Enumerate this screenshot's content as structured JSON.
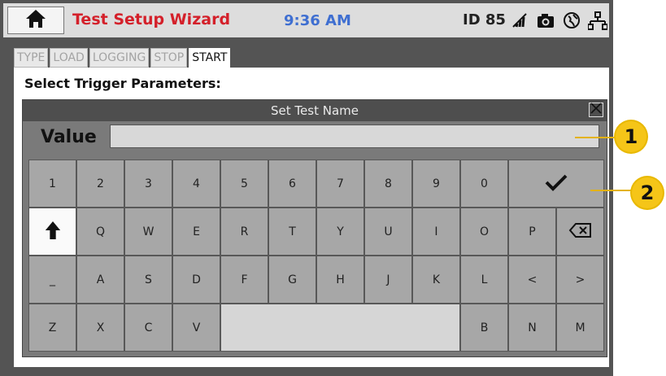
{
  "header": {
    "title": "Test Setup Wizard",
    "time": "9:36 AM",
    "device_id": "ID 85",
    "status_icons": [
      "wifi-off-icon",
      "camera-icon",
      "globe-icon",
      "network-icon"
    ],
    "colors": {
      "title": "#d4202a",
      "time": "#3f6fd1"
    }
  },
  "tabs": [
    {
      "label": "TYPE",
      "active": false
    },
    {
      "label": "LOAD",
      "active": false
    },
    {
      "label": "LOGGING",
      "active": false
    },
    {
      "label": "STOP",
      "active": false
    },
    {
      "label": "START",
      "active": true
    }
  ],
  "panel": {
    "heading": "Select Trigger Parameters:"
  },
  "dialog": {
    "title": "Set Test Name",
    "value_label": "Value",
    "value": "",
    "enter_key": "✔",
    "shift_key": "🡅",
    "backspace_key": "⌫"
  },
  "keyboard": {
    "row1": [
      "1",
      "2",
      "3",
      "4",
      "5",
      "6",
      "7",
      "8",
      "9",
      "0"
    ],
    "row2": [
      "Q",
      "W",
      "E",
      "R",
      "T",
      "Y",
      "U",
      "I",
      "O",
      "P"
    ],
    "row3": [
      "_",
      "A",
      "S",
      "D",
      "F",
      "G",
      "H",
      "J",
      "K",
      "L",
      "<",
      ">"
    ],
    "row4": [
      "Z",
      "X",
      "C",
      "V",
      "B",
      "N",
      "M"
    ]
  },
  "callouts": [
    "1",
    "2"
  ]
}
